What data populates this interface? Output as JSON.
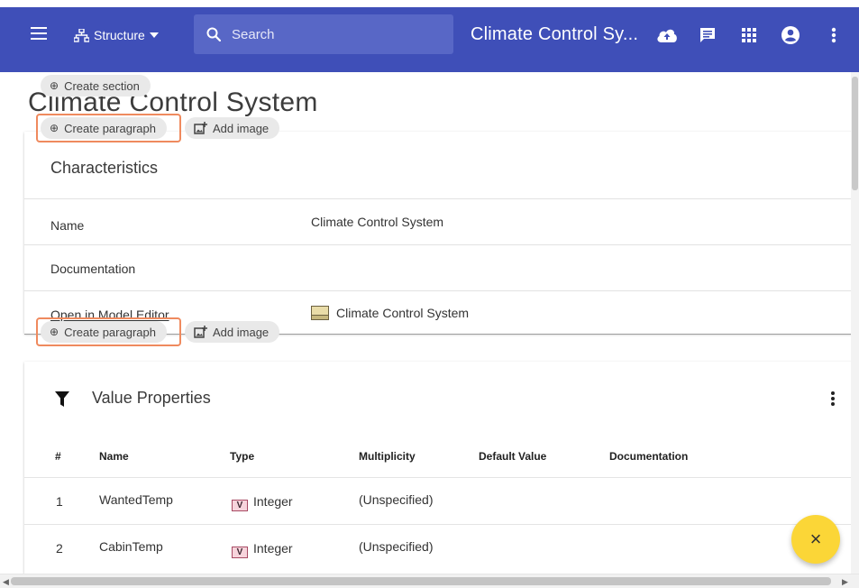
{
  "app_bar": {
    "structure_label": "Structure",
    "search_placeholder": "Search",
    "document_title": "Climate Control Sy..."
  },
  "page": {
    "title": "Climate Control System",
    "create_section_label": "Create section",
    "create_paragraph_label": "Create paragraph",
    "add_image_label": "Add image"
  },
  "characteristics": {
    "heading": "Characteristics",
    "rows": [
      {
        "key": "Name",
        "value": "Climate Control System"
      },
      {
        "key": "Documentation",
        "value": ""
      },
      {
        "key": "Open in Model Editor",
        "value": "Climate Control System"
      }
    ]
  },
  "value_properties": {
    "heading": "Value Properties",
    "columns": [
      "#",
      "Name",
      "Type",
      "Multiplicity",
      "Default Value",
      "Documentation"
    ],
    "type_badge": "V",
    "rows": [
      {
        "num": "1",
        "name": "WantedTemp",
        "type": "Integer",
        "multiplicity": "(Unspecified)",
        "default": "",
        "doc": ""
      },
      {
        "num": "2",
        "name": "CabinTemp",
        "type": "Integer",
        "multiplicity": "(Unspecified)",
        "default": "",
        "doc": ""
      }
    ]
  },
  "fab": {
    "symbol": "×"
  },
  "colors": {
    "app_bar": "#3f4fb8",
    "search_box": "#5867c6",
    "highlight": "#ef8a5e",
    "fab": "#fbd637",
    "type_badge_bg": "#f7d4dc",
    "type_badge_border": "#a74a63"
  },
  "icons": {
    "menu": "menu-icon",
    "structure": "sitemap-icon",
    "search": "search-icon",
    "cloud": "cloud-upload-icon",
    "comments": "comment-icon",
    "apps": "apps-grid-icon",
    "account": "account-circle-icon",
    "more": "more-vert-icon",
    "filter": "filter-icon",
    "create": "add-circle-outline-icon",
    "add_image": "add-image-icon",
    "model_element": "model-element-icon",
    "close": "close-icon"
  }
}
